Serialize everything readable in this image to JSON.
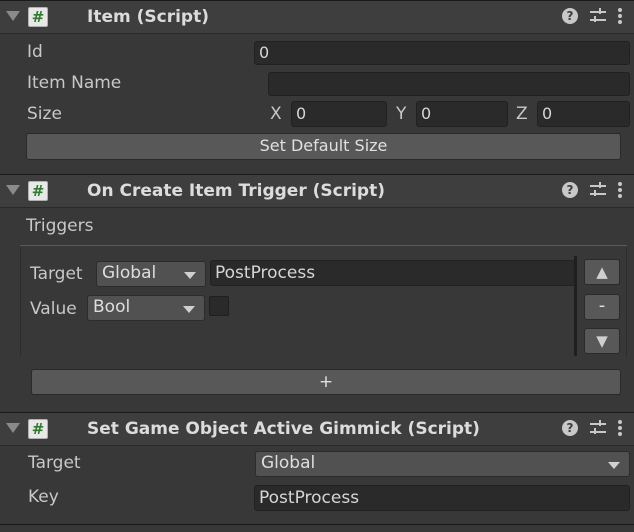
{
  "item": {
    "title": "Item (Script)",
    "id_label": "Id",
    "id_value": "0",
    "name_label": "Item Name",
    "name_value": "",
    "size_label": "Size",
    "x_label": "X",
    "x_value": "0",
    "y_label": "Y",
    "y_value": "0",
    "z_label": "Z",
    "z_value": "0",
    "default_button": "Set Default Size"
  },
  "trigger": {
    "title": "On Create Item Trigger (Script)",
    "triggers_label": "Triggers",
    "target_label": "Target",
    "target_scope": "Global",
    "target_value": "PostProcess",
    "value_label": "Value",
    "value_type": "Bool",
    "checkbox_checked": false,
    "up_label": "▲",
    "remove_label": "-",
    "down_label": "▼",
    "add_label": "+"
  },
  "gimmick": {
    "title": "Set Game Object Active Gimmick (Script)",
    "target_label": "Target",
    "target_value": "Global",
    "key_label": "Key",
    "key_value": "PostProcess"
  },
  "icons": {
    "script": "#",
    "help": "?"
  }
}
